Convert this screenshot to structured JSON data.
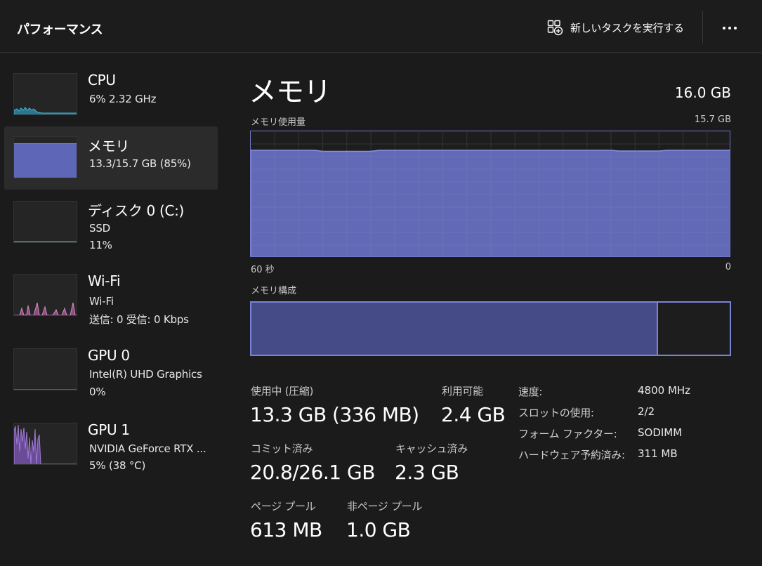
{
  "header": {
    "title": "パフォーマンス",
    "run_task_label": "新しいタスクを実行する",
    "run_task_icon": "run-new-task-icon",
    "more_icon": "more-options-icon"
  },
  "sidebar": {
    "items": [
      {
        "title": "CPU",
        "lines": [
          "6%  2.32 GHz"
        ],
        "color": "#3fb8d8"
      },
      {
        "title": "メモリ",
        "lines": [
          "13.3/15.7 GB (85%)"
        ],
        "color": "#6a72c8"
      },
      {
        "title": "ディスク 0 (C:)",
        "lines": [
          "SSD",
          "11%"
        ],
        "color": "#3fb8a0"
      },
      {
        "title": "Wi-Fi",
        "lines": [
          "Wi-Fi",
          "送信: 0  受信: 0 Kbps"
        ],
        "color": "#d68ac0"
      },
      {
        "title": "GPU 0",
        "lines": [
          "Intel(R) UHD Graphics",
          "0%"
        ],
        "color": "#a07ad8"
      },
      {
        "title": "GPU 1",
        "lines": [
          "NVIDIA GeForce RTX ...",
          "5%  (38 °C)"
        ],
        "color": "#a07ad8"
      }
    ]
  },
  "main": {
    "title": "メモリ",
    "total": "16.0 GB",
    "usage_label": "メモリ使用量",
    "usage_max": "15.7 GB",
    "time_left": "60 秒",
    "time_right": "0",
    "composition_label": "メモリ構成",
    "composition_used_fraction": 0.85,
    "usage_level_fraction": 0.85,
    "accent": "#6a72c8"
  },
  "stats": {
    "in_use_label": "使用中 (圧縮)",
    "in_use_value": "13.3 GB (336 MB)",
    "available_label": "利用可能",
    "available_value": "2.4 GB",
    "committed_label": "コミット済み",
    "committed_value": "20.8/26.1 GB",
    "cached_label": "キャッシュ済み",
    "cached_value": "2.3 GB",
    "paged_label": "ページ プール",
    "paged_value": "613 MB",
    "nonpaged_label": "非ページ プール",
    "nonpaged_value": "1.0 GB"
  },
  "details": [
    {
      "label": "速度:",
      "value": "4800 MHz"
    },
    {
      "label": "スロットの使用:",
      "value": "2/2"
    },
    {
      "label": "フォーム ファクター:",
      "value": "SODIMM"
    },
    {
      "label": "ハードウェア予約済み:",
      "value": "311 MB"
    }
  ]
}
